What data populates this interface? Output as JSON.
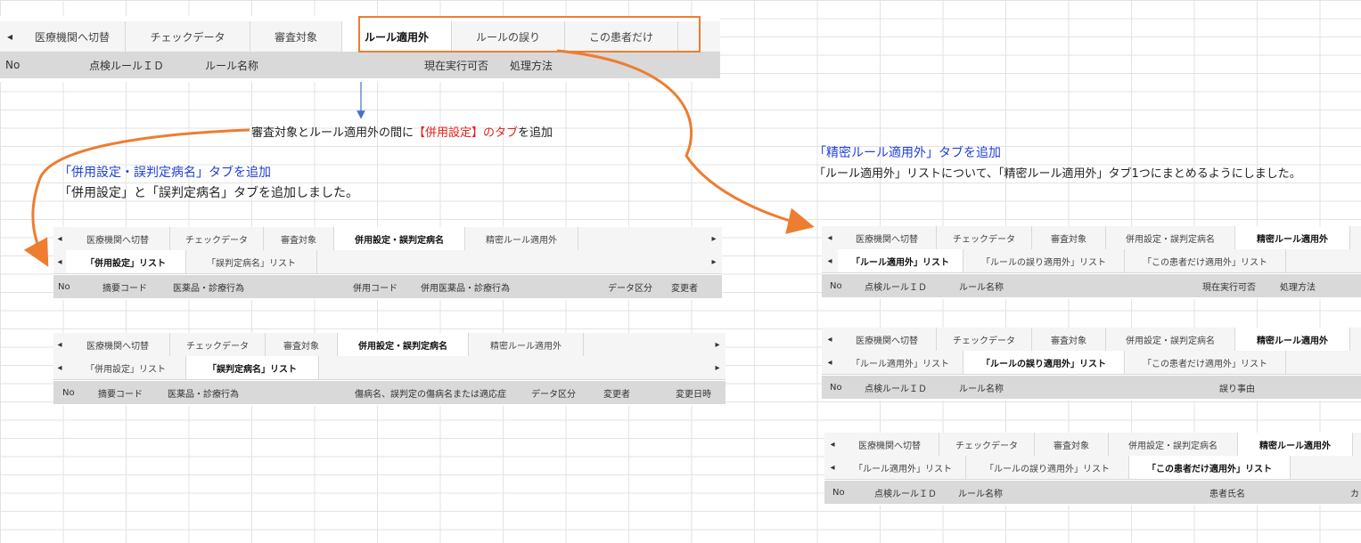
{
  "colors": {
    "accent_orange": "#ed7d31",
    "blue_text": "#1f3fd6",
    "red_text": "#e0201a",
    "header_gray": "#d9d9d9"
  },
  "top": {
    "tabs": [
      "医療機関へ切替",
      "チェックデータ",
      "審査対象",
      "ルール適用外",
      "ルールの誤り",
      "この患者だけ"
    ],
    "active": "ルール適用外",
    "cols": [
      "No",
      "点検ルールＩＤ",
      "ルール名称",
      "現在実行可否",
      "処理方法"
    ]
  },
  "notes": {
    "middle_prefix": "審査対象とルール適用外の間に",
    "middle_red": "【併用設定】のタブ",
    "middle_suffix": "を追加",
    "left_title": "「併用設定・誤判定病名」タブを追加",
    "left_desc": "「併用設定」と「誤判定病名」タブを追加しました。",
    "right_title": "「精密ルール適用外」タブを追加",
    "right_desc": "「ルール適用外」リストについて、「精密ルール適用外」タブ1つにまとめるようにしました。"
  },
  "left1": {
    "tabs": [
      "医療機関へ切替",
      "チェックデータ",
      "審査対象",
      "併用設定・誤判定病名",
      "精密ルール適用外"
    ],
    "subtabs": [
      "「併用設定」リスト",
      "「誤判定病名」リスト"
    ],
    "cols": [
      "No",
      "摘要コード",
      "医薬品・診療行為",
      "併用コード",
      "併用医薬品・診療行為",
      "データ区分",
      "変更者"
    ]
  },
  "left2": {
    "tabs": [
      "医療機関へ切替",
      "チェックデータ",
      "審査対象",
      "併用設定・誤判定病名",
      "精密ルール適用外"
    ],
    "subtabs": [
      "「併用設定」リスト",
      "「誤判定病名」リスト"
    ],
    "cols": [
      "No",
      "摘要コード",
      "医薬品・診療行為",
      "傷病名、誤判定の傷病名または適応症",
      "データ区分",
      "変更者",
      "変更日時"
    ]
  },
  "right1": {
    "tabs": [
      "医療機関へ切替",
      "チェックデータ",
      "審査対象",
      "併用設定・誤判定病名",
      "精密ルール適用外"
    ],
    "subtabs": [
      "「ルール適用外」リスト",
      "「ルールの誤り適用外」リスト",
      "「この患者だけ適用外」リスト"
    ],
    "cols": [
      "No",
      "点検ルールＩＤ",
      "ルール名称",
      "現在実行可否",
      "処理方法"
    ]
  },
  "right2": {
    "tabs": [
      "医療機関へ切替",
      "チェックデータ",
      "審査対象",
      "併用設定・誤判定病名",
      "精密ルール適用外"
    ],
    "subtabs": [
      "「ルール適用外」リスト",
      "「ルールの誤り適用外」リスト",
      "「この患者だけ適用外」リスト"
    ],
    "cols": [
      "No",
      "点検ルールＩＤ",
      "ルール名称",
      "誤り事由"
    ]
  },
  "right3": {
    "tabs": [
      "医療機関へ切替",
      "チェックデータ",
      "審査対象",
      "併用設定・誤判定病名",
      "精密ルール適用外"
    ],
    "subtabs": [
      "「ルール適用外」リスト",
      "「ルールの誤り適用外」リスト",
      "「この患者だけ適用外」リスト"
    ],
    "cols": [
      "No",
      "点検ルールＩＤ",
      "ルール名称",
      "患者氏名",
      "カ"
    ]
  },
  "glyphs": {
    "left": "◂",
    "right": "▸"
  }
}
